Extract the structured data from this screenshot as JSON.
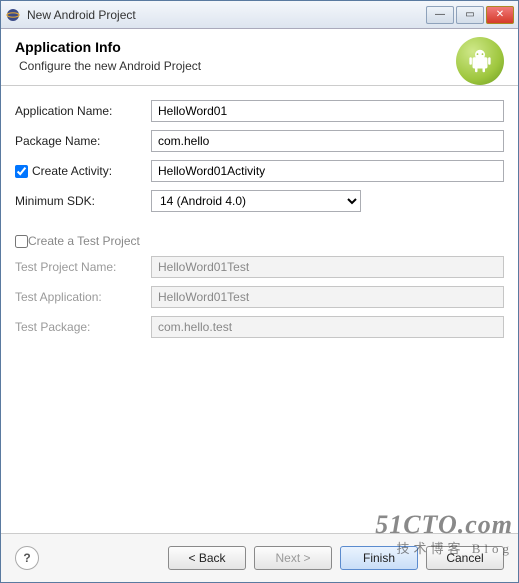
{
  "titlebar": {
    "title": "New Android Project"
  },
  "header": {
    "title": "Application Info",
    "subtitle": "Configure the new Android Project"
  },
  "form": {
    "applicationName": {
      "label": "Application Name:",
      "value": "HelloWord01"
    },
    "packageName": {
      "label": "Package Name:",
      "value": "com.hello"
    },
    "createActivity": {
      "label": "Create Activity:",
      "checked": true,
      "value": "HelloWord01Activity"
    },
    "minimumSdk": {
      "label": "Minimum SDK:",
      "value": "14 (Android 4.0)"
    },
    "createTestProject": {
      "label": "Create a Test Project",
      "checked": false
    },
    "testProjectName": {
      "label": "Test Project Name:",
      "value": "HelloWord01Test"
    },
    "testApplication": {
      "label": "Test Application:",
      "value": "HelloWord01Test"
    },
    "testPackage": {
      "label": "Test Package:",
      "value": "com.hello.test"
    }
  },
  "footer": {
    "help": "?",
    "back": "< Back",
    "next": "Next >",
    "finish": "Finish",
    "cancel": "Cancel"
  },
  "watermark": {
    "big": "51CTO.com",
    "small": "技术博客  Blog"
  }
}
